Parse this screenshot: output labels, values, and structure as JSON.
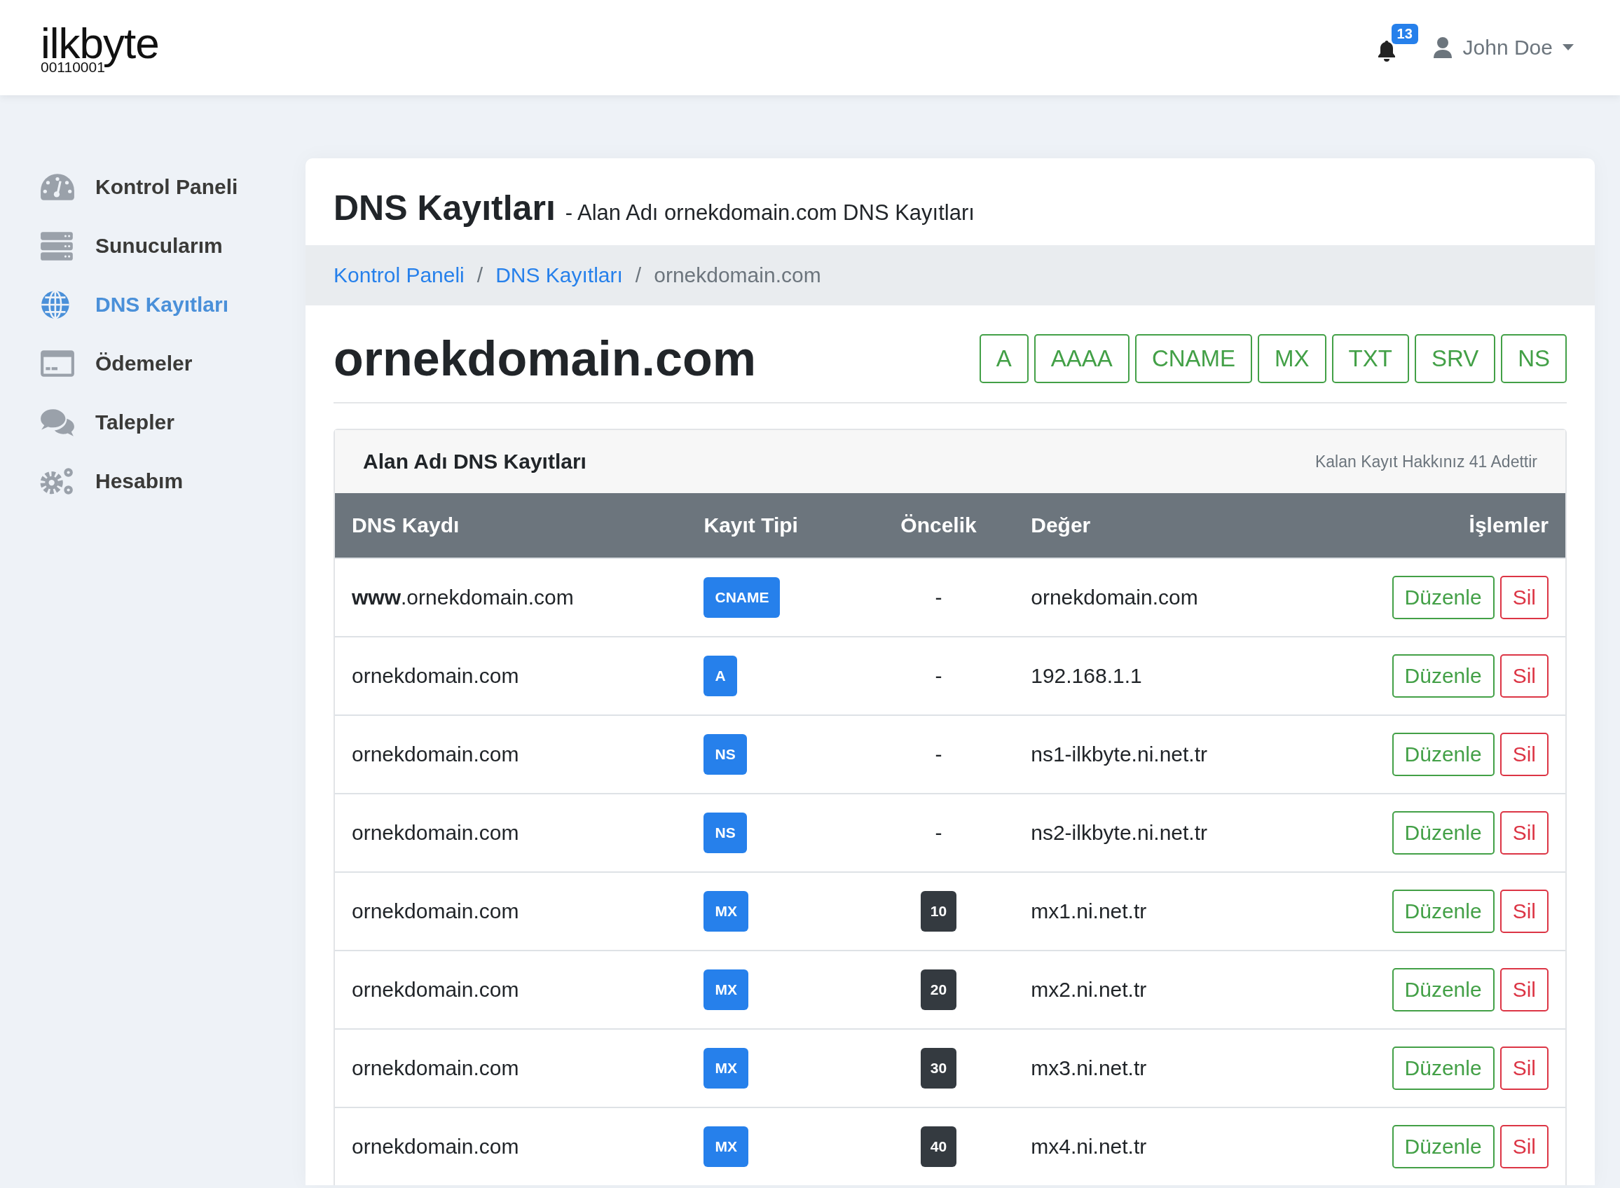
{
  "header": {
    "logo": {
      "name": "ilkbyte",
      "code": "00110001"
    },
    "notifications": {
      "count": "13"
    },
    "user": {
      "name": "John Doe"
    }
  },
  "sidebar": {
    "items": [
      {
        "label": "Kontrol Paneli",
        "selected": false
      },
      {
        "label": "Sunucularım",
        "selected": false
      },
      {
        "label": "DNS Kayıtları",
        "selected": true
      },
      {
        "label": "Ödemeler",
        "selected": false
      },
      {
        "label": "Talepler",
        "selected": false
      },
      {
        "label": "Hesabım",
        "selected": false
      }
    ]
  },
  "page": {
    "title": "DNS Kayıtları",
    "subtitle": "- Alan Adı ornekdomain.com DNS Kayıtları",
    "breadcrumb": [
      {
        "kind": "link",
        "label": "Kontrol Paneli"
      },
      {
        "kind": "separator",
        "label": "/"
      },
      {
        "kind": "link",
        "label": "DNS Kayıtları"
      },
      {
        "kind": "separator",
        "label": "/"
      },
      {
        "kind": "current",
        "label": "ornekdomain.com"
      }
    ],
    "domain": "ornekdomain.com",
    "add_buttons": [
      "A",
      "AAAA",
      "CNAME",
      "MX",
      "TXT",
      "SRV",
      "NS"
    ]
  },
  "records_panel": {
    "title": "Alan Adı DNS Kayıtları",
    "quota": "Kalan Kayıt Hakkınız 41 Adettir",
    "columns": [
      "DNS Kaydı",
      "Kayıt Tipi",
      "Öncelik",
      "Değer",
      "İşlemler"
    ],
    "rows": [
      {
        "name": "**www**.ornekdomain.com",
        "type": "CNAME",
        "priority": "-",
        "kind": "plain",
        "value": "ornekdomain.com",
        "actions": [
          "Düzenle",
          "Sil"
        ]
      },
      {
        "name": "ornekdomain.com",
        "type": "A",
        "priority": "-",
        "kind": "plain",
        "value": "192.168.1.1",
        "actions": [
          "Düzenle",
          "Sil"
        ]
      },
      {
        "name": "ornekdomain.com",
        "type": "NS",
        "priority": "-",
        "kind": "plain",
        "value": "ns1-ilkbyte.ni.net.tr",
        "actions": [
          "Düzenle",
          "Sil"
        ]
      },
      {
        "name": "ornekdomain.com",
        "type": "NS",
        "priority": "-",
        "kind": "plain",
        "value": "ns2-ilkbyte.ni.net.tr",
        "actions": [
          "Düzenle",
          "Sil"
        ]
      },
      {
        "name": "ornekdomain.com",
        "type": "MX",
        "priority": "10",
        "kind": "badge",
        "value": "mx1.ni.net.tr",
        "actions": [
          "Düzenle",
          "Sil"
        ]
      },
      {
        "name": "ornekdomain.com",
        "type": "MX",
        "priority": "20",
        "kind": "badge",
        "value": "mx2.ni.net.tr",
        "actions": [
          "Düzenle",
          "Sil"
        ]
      },
      {
        "name": "ornekdomain.com",
        "type": "MX",
        "priority": "30",
        "kind": "badge",
        "value": "mx3.ni.net.tr",
        "actions": [
          "Düzenle",
          "Sil"
        ]
      },
      {
        "name": "ornekdomain.com",
        "type": "MX",
        "priority": "40",
        "kind": "badge",
        "value": "mx4.ni.net.tr",
        "actions": [
          "Düzenle",
          "Sil"
        ]
      }
    ]
  }
}
